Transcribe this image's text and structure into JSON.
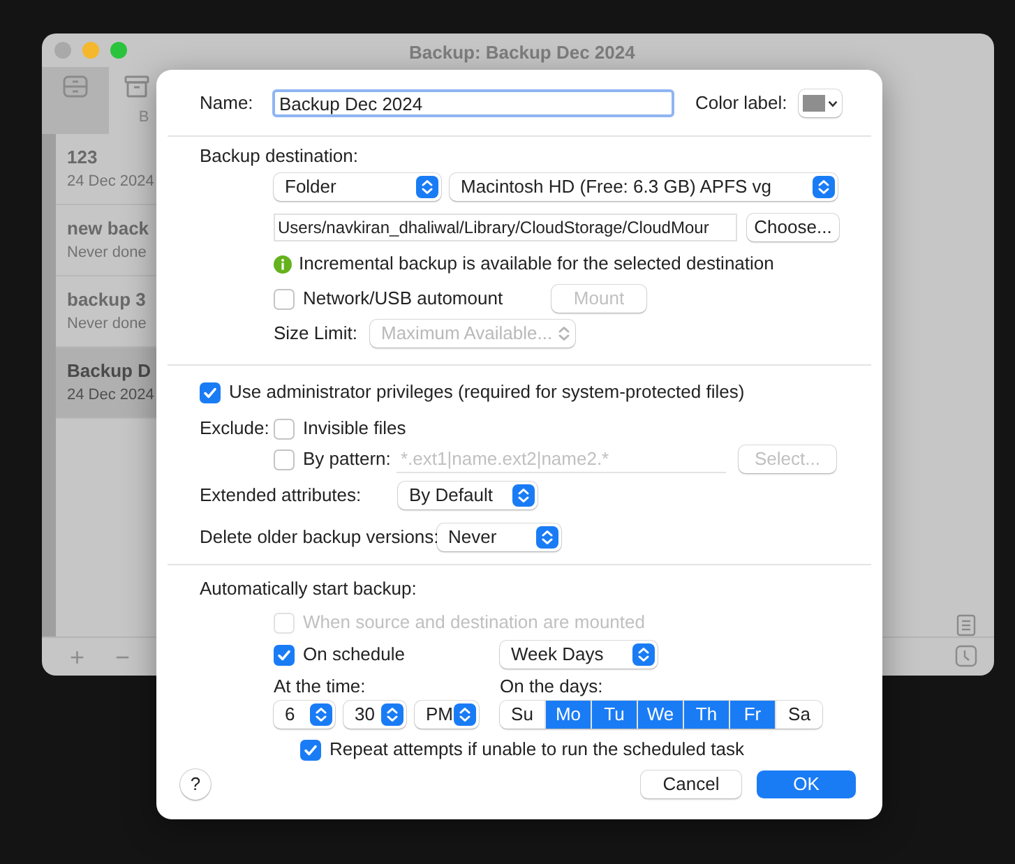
{
  "window": {
    "title": "Backup: Backup Dec 2024",
    "toolbar_label": "B"
  },
  "sidebar": {
    "items": [
      {
        "name": "123",
        "status": "24 Dec 2024",
        "selected": false
      },
      {
        "name": "new back",
        "status": "Never done",
        "selected": false
      },
      {
        "name": "backup 3",
        "status": "Never done",
        "selected": false
      },
      {
        "name": "Backup D",
        "status": "24 Dec 2024",
        "selected": true
      }
    ]
  },
  "footer_buttons": [
    "+",
    "−"
  ],
  "dialog": {
    "name_label": "Name:",
    "name_value": "Backup Dec 2024",
    "color_label": "Color label:",
    "color": "#8e8e8e",
    "destination": {
      "heading": "Backup destination:",
      "type": "Folder",
      "volume": "Macintosh HD (Free: 6.3 GB) APFS vg",
      "path": "Users/navkiran_dhaliwal/Library/CloudStorage/CloudMour",
      "choose": "Choose...",
      "info": "Incremental backup is available for the selected destination",
      "automount": {
        "label": "Network/USB automount",
        "checked": false
      },
      "mount": {
        "label": "Mount",
        "disabled": true
      },
      "size_limit_label": "Size Limit:",
      "size_limit": {
        "value": "Maximum Available...",
        "disabled": true
      }
    },
    "admin": {
      "label": "Use administrator privileges (required for system-protected files)",
      "checked": true
    },
    "exclude_label": "Exclude:",
    "invisible": {
      "label": "Invisible files",
      "checked": false
    },
    "pattern": {
      "label": "By pattern:",
      "checked": false,
      "placeholder": "*.ext1|name.ext2|name2.*",
      "select": {
        "label": "Select...",
        "disabled": true
      }
    },
    "ext_attr": {
      "label": "Extended attributes:",
      "value": "By Default"
    },
    "delete_old": {
      "label": "Delete older backup versions:",
      "value": "Never"
    },
    "auto": {
      "heading": "Automatically start backup:",
      "mounted": {
        "label": "When source and destination are mounted",
        "checked": false,
        "disabled": true
      },
      "schedule": {
        "label": "On schedule",
        "checked": true,
        "disabled": false
      },
      "frequency": "Week Days",
      "time_label": "At the time:",
      "hour": "6",
      "minute": "30",
      "ampm": "PM",
      "days_label": "On the days:",
      "days": [
        {
          "label": "Su",
          "selected": false
        },
        {
          "label": "Mo",
          "selected": true
        },
        {
          "label": "Tu",
          "selected": true
        },
        {
          "label": "We",
          "selected": true
        },
        {
          "label": "Th",
          "selected": true
        },
        {
          "label": "Fr",
          "selected": true
        },
        {
          "label": "Sa",
          "selected": false
        }
      ],
      "repeat": {
        "label": "Repeat attempts if unable to run the scheduled task",
        "checked": true,
        "disabled": false
      }
    },
    "help": "?",
    "cancel": "Cancel",
    "ok": "OK"
  }
}
